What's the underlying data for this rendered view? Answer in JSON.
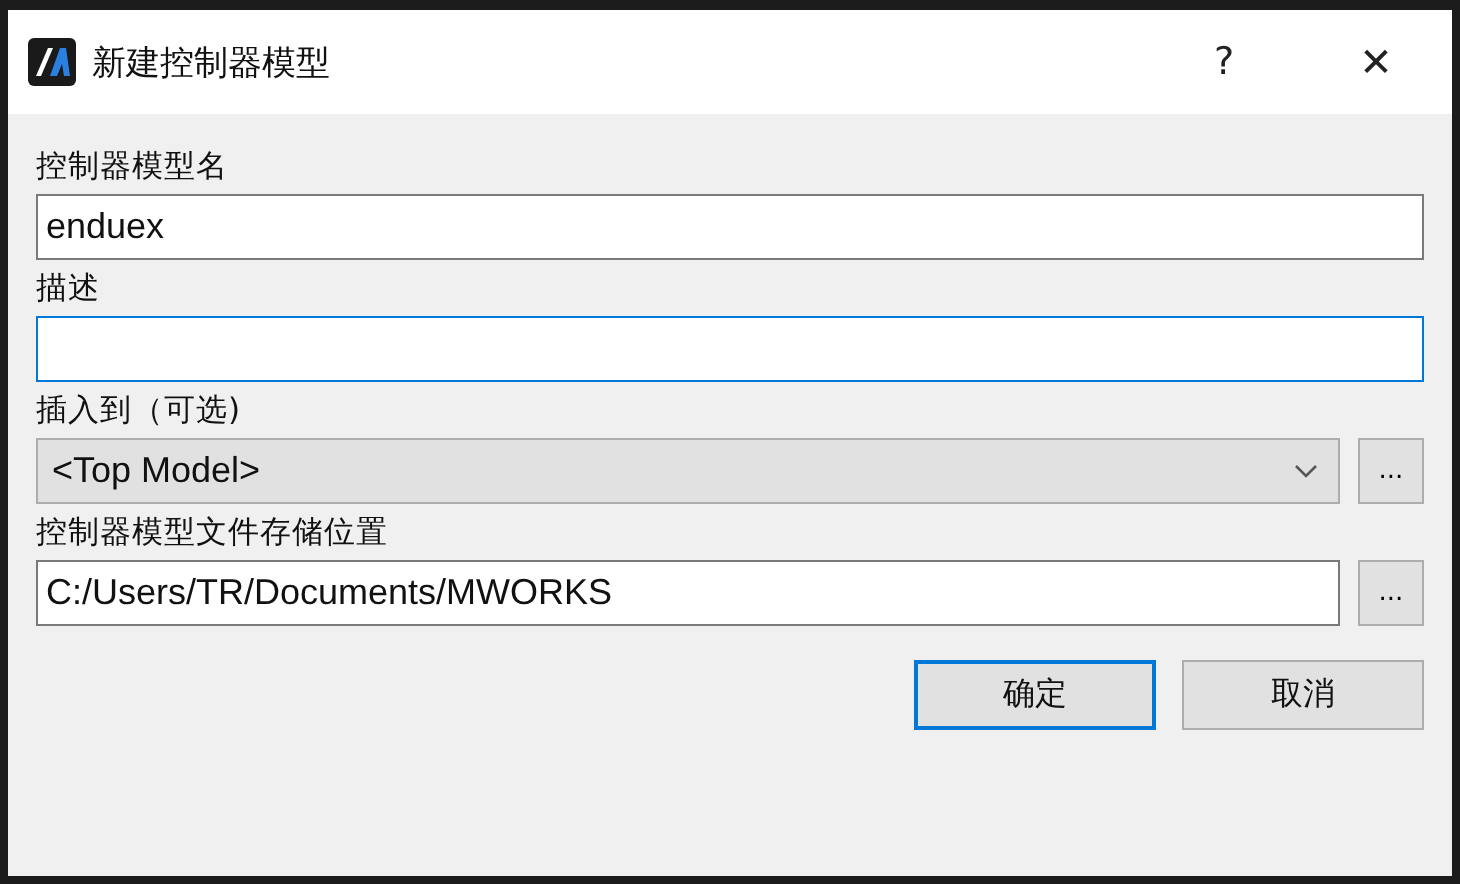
{
  "window": {
    "title": "新建控制器模型",
    "help": "?",
    "close": "✕"
  },
  "fields": [
    {
      "kind": "text",
      "label": "控制器模型名",
      "value": "enduex",
      "focused": false
    },
    {
      "kind": "text",
      "label": "描述",
      "focused": true
    },
    {
      "kind": "combo",
      "label": "插入到（可选)",
      "value": "<Top Model>",
      "browse": "..."
    },
    {
      "kind": "text",
      "label": "控制器模型文件存储位置",
      "value": "C:/Users/TR/Documents/MWORKS",
      "focused": false,
      "browse": "..."
    }
  ],
  "buttons": [
    {
      "label": "确定",
      "default": true
    },
    {
      "label": "取消",
      "default": false
    }
  ]
}
